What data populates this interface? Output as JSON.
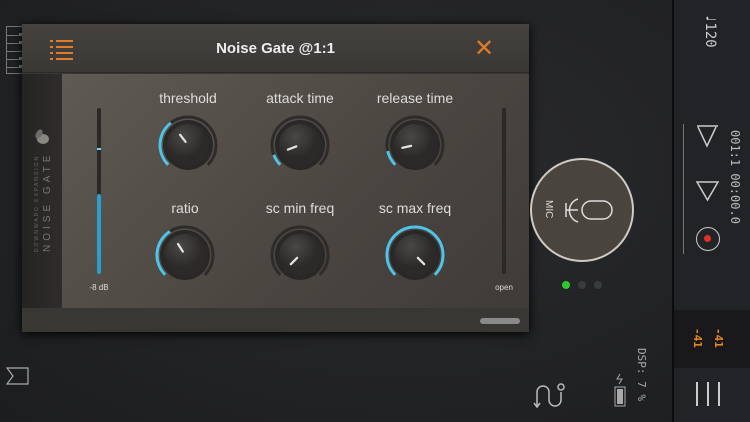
{
  "plugin": {
    "title": "Noise Gate @1:1",
    "brand_line1": "DOWNWARD EXPANSION",
    "brand_line2": "NOISE GATE",
    "input_meter": {
      "label": "-8 dB",
      "level": 0.48,
      "marker": 0.75
    },
    "output_meter": {
      "label": "open",
      "level": 0.0
    },
    "knobs": [
      {
        "label": "threshold",
        "value": 0.36
      },
      {
        "label": "attack time",
        "value": 0.09
      },
      {
        "label": "release time",
        "value": 0.12
      },
      {
        "label": "ratio",
        "value": 0.38
      },
      {
        "label": "sc min freq",
        "value": 0.0
      },
      {
        "label": "sc max freq",
        "value": 1.0
      }
    ]
  },
  "track": {
    "input_label": "MIC",
    "pages": 3,
    "active_page": 0
  },
  "transport": {
    "tempo": "♩120",
    "position": "001:1  00:00.0"
  },
  "levels": {
    "left": "-41",
    "right": "-41"
  },
  "status": {
    "dsp": "DSP: 7 %"
  },
  "colors": {
    "accent": "#e07b28",
    "knob_arc": "#4fc3e8",
    "record": "#e0302a",
    "page_active": "#2ec92e"
  }
}
